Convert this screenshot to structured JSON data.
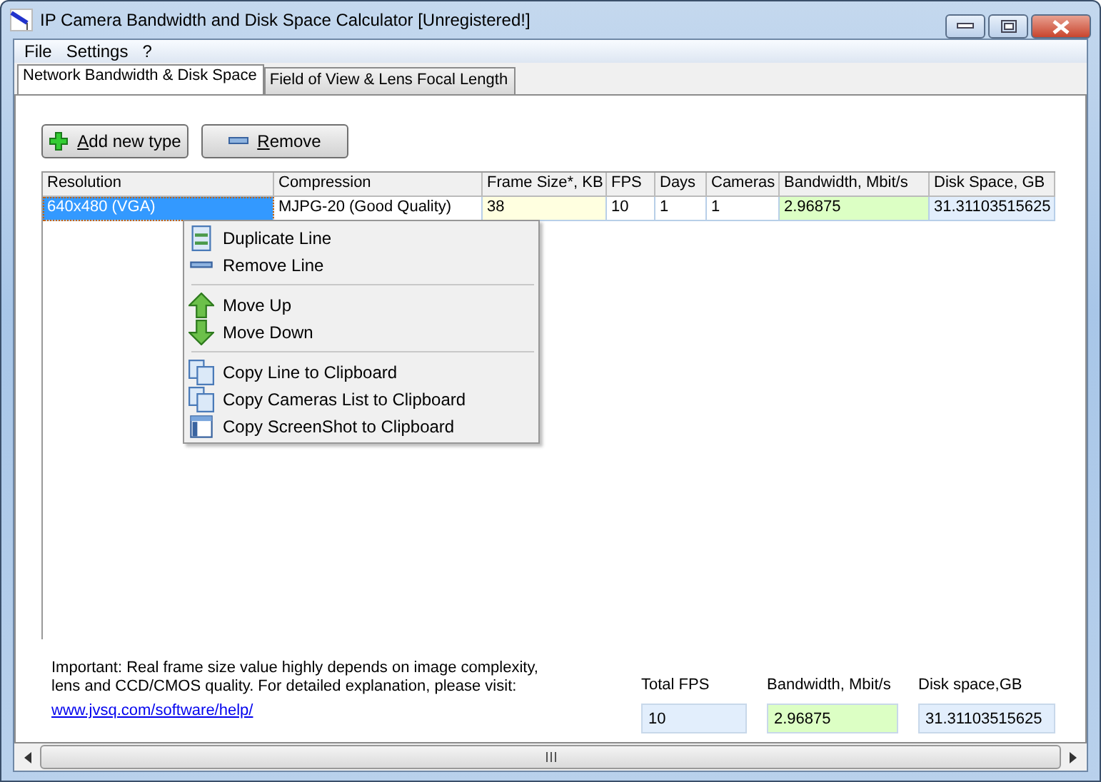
{
  "window": {
    "title": "IP Camera Bandwidth and Disk Space Calculator [Unregistered!]"
  },
  "menu": [
    "File",
    "Settings",
    "?"
  ],
  "tabs": [
    {
      "label": "Network Bandwidth & Disk Space",
      "selected": true
    },
    {
      "label": "Field of View & Lens Focal Length",
      "selected": false
    }
  ],
  "toolbar": [
    {
      "label": "Add new type",
      "kind": "add"
    },
    {
      "label": "Remove",
      "kind": "remove"
    }
  ],
  "table": {
    "columns": [
      {
        "label": "Resolution"
      },
      {
        "label": "Compression"
      },
      {
        "label": "Frame Size*, KB",
        "kind": "input"
      },
      {
        "label": "FPS"
      },
      {
        "label": "Days"
      },
      {
        "label": "Cameras"
      },
      {
        "label": "Bandwidth, Mbit/s",
        "kind": "bandwidth"
      },
      {
        "label": "Disk Space, GB",
        "kind": "disk"
      }
    ],
    "rows": [
      {
        "selected": true,
        "cells": [
          "640x480 (VGA)",
          "MJPG-20 (Good Quality)",
          "38",
          "10",
          "1",
          "1",
          "2.96875",
          "31.31103515625"
        ]
      }
    ]
  },
  "context_menu": [
    [
      {
        "label": "Duplicate Line",
        "kind": "page"
      },
      {
        "label": "Remove Line",
        "kind": "minus"
      }
    ],
    [
      {
        "label": "Move Up",
        "kind": "up"
      },
      {
        "label": "Move Down",
        "kind": "down"
      }
    ],
    [
      {
        "label": "Copy Line to Clipboard",
        "kind": "copy"
      },
      {
        "label": "Copy Cameras List to Clipboard",
        "kind": "copy"
      },
      {
        "label": "Copy ScreenShot to Clipboard",
        "kind": "window"
      }
    ]
  ],
  "footer": {
    "note": "Important: Real frame size value highly depends on image complexity, lens and CCD/CMOS quality. For detailed explanation, please visit:",
    "link": "www.jvsq.com/software/help/",
    "totals": [
      {
        "label": "Total FPS",
        "value": "10",
        "kind": "disk"
      },
      {
        "label": "Bandwidth, Mbit/s",
        "value": "2.96875",
        "kind": "bandwidth"
      },
      {
        "label": "Disk space,GB",
        "value": "31.31103515625",
        "kind": "disk"
      }
    ]
  }
}
